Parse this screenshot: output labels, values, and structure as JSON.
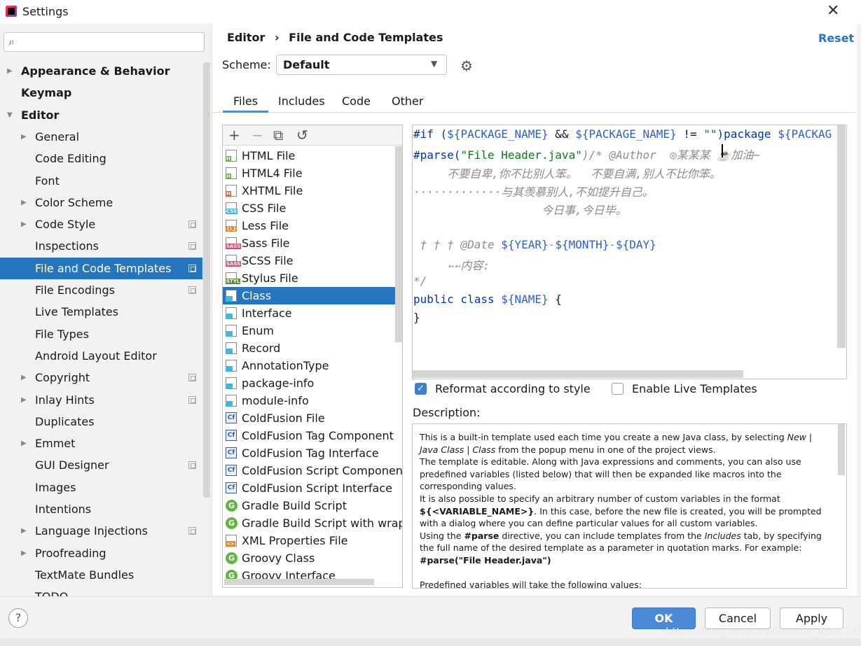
{
  "window": {
    "title": "Settings",
    "close_glyph": "✕"
  },
  "search": {
    "placeholder": ""
  },
  "sidebar": {
    "items": [
      {
        "label": "Appearance & Behavior",
        "bold": true,
        "level": 0,
        "expand": "collapsed",
        "copy": false
      },
      {
        "label": "Keymap",
        "bold": true,
        "level": 0,
        "expand": "none",
        "copy": false
      },
      {
        "label": "Editor",
        "bold": true,
        "level": 0,
        "expand": "expanded",
        "copy": false
      },
      {
        "label": "General",
        "level": 1,
        "expand": "collapsed",
        "copy": false
      },
      {
        "label": "Code Editing",
        "level": 1,
        "expand": "none",
        "copy": false
      },
      {
        "label": "Font",
        "level": 1,
        "expand": "none",
        "copy": false
      },
      {
        "label": "Color Scheme",
        "level": 1,
        "expand": "collapsed",
        "copy": false
      },
      {
        "label": "Code Style",
        "level": 1,
        "expand": "collapsed",
        "copy": true
      },
      {
        "label": "Inspections",
        "level": 1,
        "expand": "none",
        "copy": true
      },
      {
        "label": "File and Code Templates",
        "level": 1,
        "expand": "none",
        "copy": true,
        "selected": true
      },
      {
        "label": "File Encodings",
        "level": 1,
        "expand": "none",
        "copy": true
      },
      {
        "label": "Live Templates",
        "level": 1,
        "expand": "none",
        "copy": false
      },
      {
        "label": "File Types",
        "level": 1,
        "expand": "none",
        "copy": false
      },
      {
        "label": "Android Layout Editor",
        "level": 1,
        "expand": "none",
        "copy": false
      },
      {
        "label": "Copyright",
        "level": 1,
        "expand": "collapsed",
        "copy": true
      },
      {
        "label": "Inlay Hints",
        "level": 1,
        "expand": "collapsed",
        "copy": true
      },
      {
        "label": "Duplicates",
        "level": 1,
        "expand": "none",
        "copy": false
      },
      {
        "label": "Emmet",
        "level": 1,
        "expand": "collapsed",
        "copy": false
      },
      {
        "label": "GUI Designer",
        "level": 1,
        "expand": "none",
        "copy": true
      },
      {
        "label": "Images",
        "level": 1,
        "expand": "none",
        "copy": false
      },
      {
        "label": "Intentions",
        "level": 1,
        "expand": "none",
        "copy": false
      },
      {
        "label": "Language Injections",
        "level": 1,
        "expand": "collapsed",
        "copy": true
      },
      {
        "label": "Proofreading",
        "level": 1,
        "expand": "collapsed",
        "copy": false
      },
      {
        "label": "TextMate Bundles",
        "level": 1,
        "expand": "none",
        "copy": false
      },
      {
        "label": "TODO",
        "level": 1,
        "expand": "none",
        "copy": false
      }
    ]
  },
  "header": {
    "breadcrumb_parent": "Editor",
    "breadcrumb_sep": "›",
    "breadcrumb_current": "File and Code Templates",
    "reset": "Reset"
  },
  "scheme": {
    "label": "Scheme:",
    "value": "Default"
  },
  "tabs": [
    {
      "label": "Files",
      "active": true
    },
    {
      "label": "Includes"
    },
    {
      "label": "Code"
    },
    {
      "label": "Other"
    }
  ],
  "templates": [
    {
      "label": "HTML File",
      "icon": "html-file-icon",
      "tag": "H",
      "color": "#62b543"
    },
    {
      "label": "HTML4 File",
      "icon": "html-file-icon",
      "tag": "H",
      "color": "#62b543"
    },
    {
      "label": "XHTML File",
      "icon": "xhtml-file-icon",
      "tag": "H",
      "color": "#e05b2d"
    },
    {
      "label": "CSS File",
      "icon": "css-file-icon",
      "tag": "CSS",
      "color": "#40b6e0"
    },
    {
      "label": "Less File",
      "icon": "less-file-icon",
      "tag": "{L}",
      "color": "#e0862d"
    },
    {
      "label": "Sass File",
      "icon": "sass-file-icon",
      "tag": "SASS",
      "color": "#d94b6f"
    },
    {
      "label": "SCSS File",
      "icon": "scss-file-icon",
      "tag": "SASS",
      "color": "#d94b6f"
    },
    {
      "label": "Stylus File",
      "icon": "stylus-file-icon",
      "tag": "STYL",
      "color": "#5a8a3a"
    },
    {
      "label": "Class",
      "icon": "java-class-icon",
      "kind": "class",
      "selected": true
    },
    {
      "label": "Interface",
      "icon": "java-class-icon",
      "kind": "class"
    },
    {
      "label": "Enum",
      "icon": "java-class-icon",
      "kind": "class"
    },
    {
      "label": "Record",
      "icon": "java-class-icon",
      "kind": "class"
    },
    {
      "label": "AnnotationType",
      "icon": "java-class-icon",
      "kind": "class"
    },
    {
      "label": "package-info",
      "icon": "java-class-icon",
      "kind": "class"
    },
    {
      "label": "module-info",
      "icon": "java-class-icon",
      "kind": "class"
    },
    {
      "label": "ColdFusion File",
      "icon": "coldfusion-icon",
      "kind": "cf"
    },
    {
      "label": "ColdFusion Tag Component",
      "icon": "coldfusion-icon",
      "kind": "cf"
    },
    {
      "label": "ColdFusion Tag Interface",
      "icon": "coldfusion-icon",
      "kind": "cf"
    },
    {
      "label": "ColdFusion Script Component",
      "icon": "coldfusion-icon",
      "kind": "cf"
    },
    {
      "label": "ColdFusion Script Interface",
      "icon": "coldfusion-icon",
      "kind": "cf"
    },
    {
      "label": "Gradle Build Script",
      "icon": "gradle-icon",
      "kind": "g"
    },
    {
      "label": "Gradle Build Script with wrappe",
      "icon": "gradle-icon",
      "kind": "g"
    },
    {
      "label": "XML Properties File",
      "icon": "xml-file-icon",
      "tag": "<>",
      "color": "#e0862d"
    },
    {
      "label": "Groovy Class",
      "icon": "groovy-icon",
      "kind": "g"
    },
    {
      "label": "Groovy Interface",
      "icon": "groovy-icon",
      "kind": "g"
    }
  ],
  "toolbar": {
    "add": "+",
    "remove": "−",
    "copy": "⧉",
    "reset": "↺"
  },
  "editor": {
    "l1": [
      "#if (",
      "${PACKAGE_NAME}",
      " && ",
      "${PACKAGE_NAME}",
      " != ",
      "\"\"",
      ")package ",
      "${PACKAG"
    ],
    "l2": [
      "#parse(",
      "\"File Header.java\"",
      ")/* @Author  ",
      "◎某某某 ☕加油~"
    ],
    "l3": "     不要自卑,你不比别人笨。  不要自满,别人不比你笨。",
    "l4": "·············与其羡慕别人,不如提升自己。",
    "l5": "                   今日事,今日毕。",
    "l7": [
      " † † † @Date ",
      "${YEAR}",
      "-",
      "${MONTH}",
      "-",
      "${DAY}"
    ],
    "l8": "     ➳➳内容:",
    "l9": "*/",
    "l10": [
      "public class ",
      "${NAME}",
      " {"
    ],
    "l11": "}"
  },
  "options": {
    "reformat": "Reformat according to style",
    "reformat_checked": true,
    "live": "Enable Live Templates",
    "live_checked": false,
    "check_glyph": "✓"
  },
  "description": {
    "label": "Description:",
    "p1a": "This is a built-in template used each time you create a new Java class, by selecting ",
    "p1b": "New | Java Class",
    "p1c": " | ",
    "p1d": "Class",
    "p1e": " from the popup menu in one of the project views.",
    "p2": "The template is editable. Along with Java expressions and comments, you can also use predefined variables (listed below) that will then be expanded like macros into the corresponding values.",
    "p3a": "It is also possible to specify an arbitrary number of custom variables in the format ",
    "p3b": "${<VARIABLE_NAME>}",
    "p3c": ". In this case, before the new file is created, you will be prompted with a dialog where you can define particular values for all custom variables.",
    "p4a": "Using the ",
    "p4b": "#parse",
    "p4c": " directive, you can include templates from the ",
    "p4d": "Includes",
    "p4e": " tab, by specifying the full name of the desired template as a parameter in quotation marks. For example:",
    "p4f": "#parse(\"File Header.java\")",
    "p5": "Predefined variables will take the following values:"
  },
  "buttons": {
    "help": "?",
    "ok": "OK",
    "cancel": "Cancel",
    "apply": "Apply"
  },
  "watermark": "https://blog.csdn.net/weixin_45967375"
}
